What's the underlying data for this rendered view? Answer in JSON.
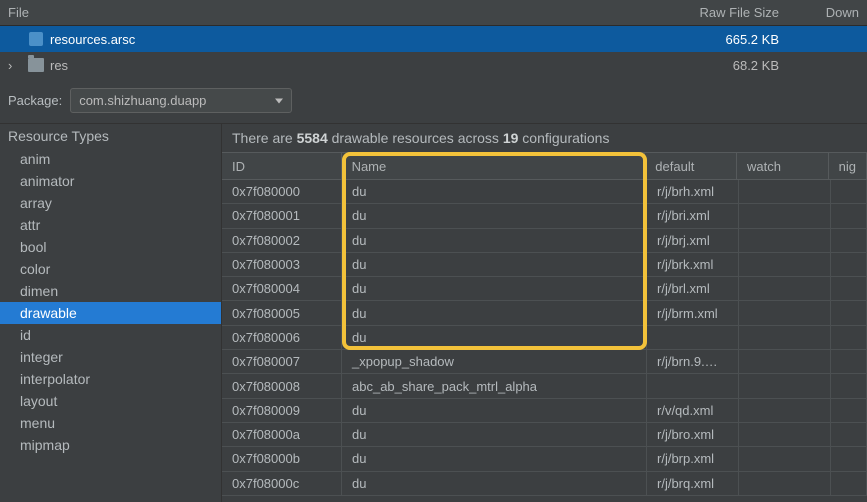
{
  "header": {
    "file": "File",
    "raw": "Raw File Size",
    "down": "Down"
  },
  "tree": [
    {
      "name": "resources.arsc",
      "icon": "arsc",
      "size": "665.2 KB",
      "selected": true
    },
    {
      "name": "res",
      "icon": "folder",
      "size": "68.2 KB",
      "expandable": true
    }
  ],
  "package": {
    "label": "Package:",
    "value": "com.shizhuang.duapp"
  },
  "sidebar": {
    "title": "Resource Types",
    "items": [
      "anim",
      "animator",
      "array",
      "attr",
      "bool",
      "color",
      "dimen",
      "drawable",
      "id",
      "integer",
      "interpolator",
      "layout",
      "menu",
      "mipmap"
    ],
    "selected": "drawable"
  },
  "summary": {
    "pre": "There are ",
    "count": "5584",
    "mid": " drawable resources across ",
    "configs": "19",
    "post": " configurations"
  },
  "table": {
    "columns": {
      "id": "ID",
      "name": "Name",
      "default": "default",
      "watch": "watch",
      "nig": "nig"
    },
    "rows": [
      {
        "id": "0x7f080000",
        "name": "du",
        "default": "r/j/brh.xml"
      },
      {
        "id": "0x7f080001",
        "name": "du",
        "default": "r/j/bri.xml"
      },
      {
        "id": "0x7f080002",
        "name": "du",
        "default": "r/j/brj.xml"
      },
      {
        "id": "0x7f080003",
        "name": "du",
        "default": "r/j/brk.xml"
      },
      {
        "id": "0x7f080004",
        "name": "du",
        "default": "r/j/brl.xml"
      },
      {
        "id": "0x7f080005",
        "name": "du",
        "default": "r/j/brm.xml"
      },
      {
        "id": "0x7f080006",
        "name": "du",
        "default": ""
      },
      {
        "id": "0x7f080007",
        "name": "_xpopup_shadow",
        "default": "r/j/brn.9.…"
      },
      {
        "id": "0x7f080008",
        "name": "abc_ab_share_pack_mtrl_alpha",
        "default": ""
      },
      {
        "id": "0x7f080009",
        "name": "du",
        "default": "r/v/qd.xml"
      },
      {
        "id": "0x7f08000a",
        "name": "du",
        "default": "r/j/bro.xml"
      },
      {
        "id": "0x7f08000b",
        "name": "du",
        "default": "r/j/brp.xml"
      },
      {
        "id": "0x7f08000c",
        "name": "du",
        "default": "r/j/brq.xml"
      }
    ]
  }
}
